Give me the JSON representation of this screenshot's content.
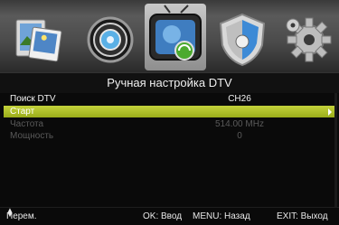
{
  "top_menu": {
    "items": [
      {
        "icon": "media-photo-icon"
      },
      {
        "icon": "speaker-audio-icon"
      },
      {
        "icon": "tv-channel-icon",
        "selected": true
      },
      {
        "icon": "shield-lock-icon"
      },
      {
        "icon": "gear-settings-icon"
      }
    ],
    "colors": {
      "selected_bg": "#b0b0b0",
      "bar_bg": "#4a4a4a"
    }
  },
  "title": "Ручная настройка DTV",
  "menu": {
    "rows": [
      {
        "label": "Поиск DTV",
        "value": "CH26",
        "state": "normal"
      },
      {
        "label": "Старт",
        "value": "",
        "state": "highlight"
      },
      {
        "label": "Частота",
        "value": "514.00 MHz",
        "state": "disabled"
      },
      {
        "label": "Мощность",
        "value": "0",
        "state": "disabled"
      }
    ],
    "highlight_color": "#b3c22c"
  },
  "help": {
    "nav": "Перем.",
    "ok": "OK: Ввод",
    "menu": "MENU: Назад",
    "exit": "EXIT: Выход"
  }
}
